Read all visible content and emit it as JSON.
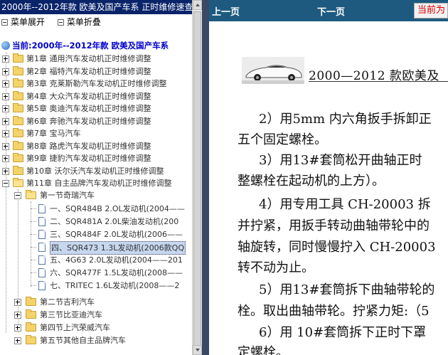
{
  "window_title": "2000年--2012年款 欧美及国产车系 正时维修速查",
  "toolbar": {
    "expand_label": "菜单展开",
    "collapse_label": "菜单折叠"
  },
  "tree": {
    "root_label": "当前:2000年--2012年款 欧美及国产车系",
    "chapters": [
      "第1章 通用汽车发动机正时维修调整",
      "第2章 福特汽车发动机正时维修调整",
      "第3章 克莱斯勒汽车发动机正时维修调整",
      "第4章 大众汽车发动机正时维修调整",
      "第5章 奥迪汽车发动机正时维修调整",
      "第6章 奔驰汽车发动机正时维修调整",
      "第7章 宝马汽车",
      "第8章 路虎汽车发动机正时维修调整",
      "第9章 捷豹汽车发动机正时维修调整",
      "第10章 沃尔沃汽车发动机正时维修调整",
      "第11章 自主品牌汽车发动机正时维修调整"
    ],
    "open_section": "第一节奇瑞汽车",
    "documents": [
      "一、SQR484B 2.OL发动机(2004——",
      "二、SQR481A 2.0L柴油发动机(200",
      "三、SQR484F 2.0L发动机(2006——",
      "四、SQR473 1.3L发动机(2006款QQ",
      "五、4G63 2.0L发动机(2004——201",
      "六、SQR477F 1.5L发动机(2008——",
      "七、TRITEC 1.6L发动机(2008——2"
    ],
    "selected_document_index": 3,
    "other_sections": [
      "第二节吉利汽车",
      "第三节比亚迪汽车",
      "第四节上汽荣威汽车",
      "第五节其他自主品牌汽车"
    ]
  },
  "nav": {
    "prev_label": "上一页",
    "next_label": "下一页",
    "current_label": "当前为"
  },
  "document": {
    "heading": "2000—2012 款欧美及",
    "lines": [
      "2）用5mm 内六角扳手拆卸正",
      "五个固定螺栓。",
      "3）用13#套筒松开曲轴正时",
      "整螺栓在起动机的上方）。",
      "4）用专用工具 CH-20003 拆",
      "并拧紧，用扳手转动曲轴带轮中的",
      "轴旋转，同时慢慢拧入 CH-20003",
      "转不动为止。",
      "5）用13#套筒拆下曲轴带轮的",
      "栓。取出曲轴带轮。拧紧力矩:（5",
      "6）用 10#套筒拆下正时下罩",
      "定螺栓。"
    ]
  },
  "colors": {
    "title_bar": "#0a246a",
    "nav_bar": "#1e5a7f",
    "root_label": "#0000cc",
    "splitter": "#3a4a64"
  }
}
